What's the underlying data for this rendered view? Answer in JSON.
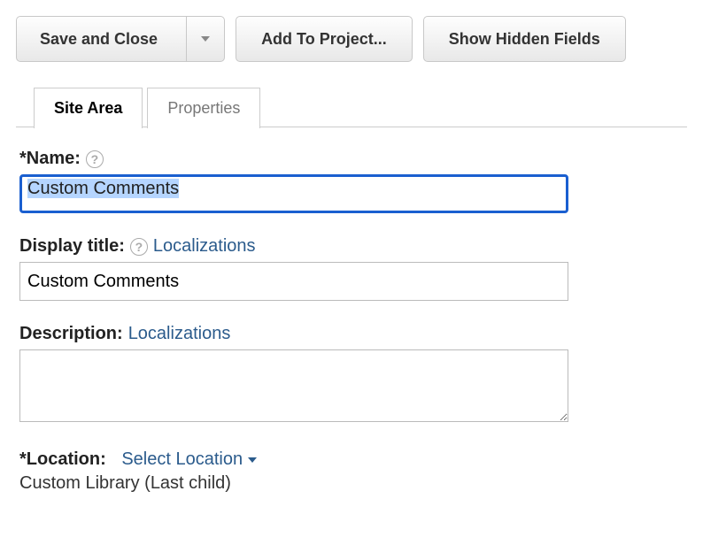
{
  "toolbar": {
    "save_close": "Save and Close",
    "add_to_project": "Add To Project...",
    "show_hidden": "Show Hidden Fields"
  },
  "tabs": {
    "site_area": "Site Area",
    "properties": "Properties"
  },
  "fields": {
    "name": {
      "label": "*Name:",
      "value": "Custom Comments"
    },
    "display_title": {
      "label": "Display title:",
      "localizations": "Localizations",
      "value": "Custom Comments"
    },
    "description": {
      "label": "Description:",
      "localizations": "Localizations",
      "value": ""
    },
    "location": {
      "label": "*Location:",
      "select": "Select Location",
      "value": "Custom Library (Last child)"
    }
  }
}
